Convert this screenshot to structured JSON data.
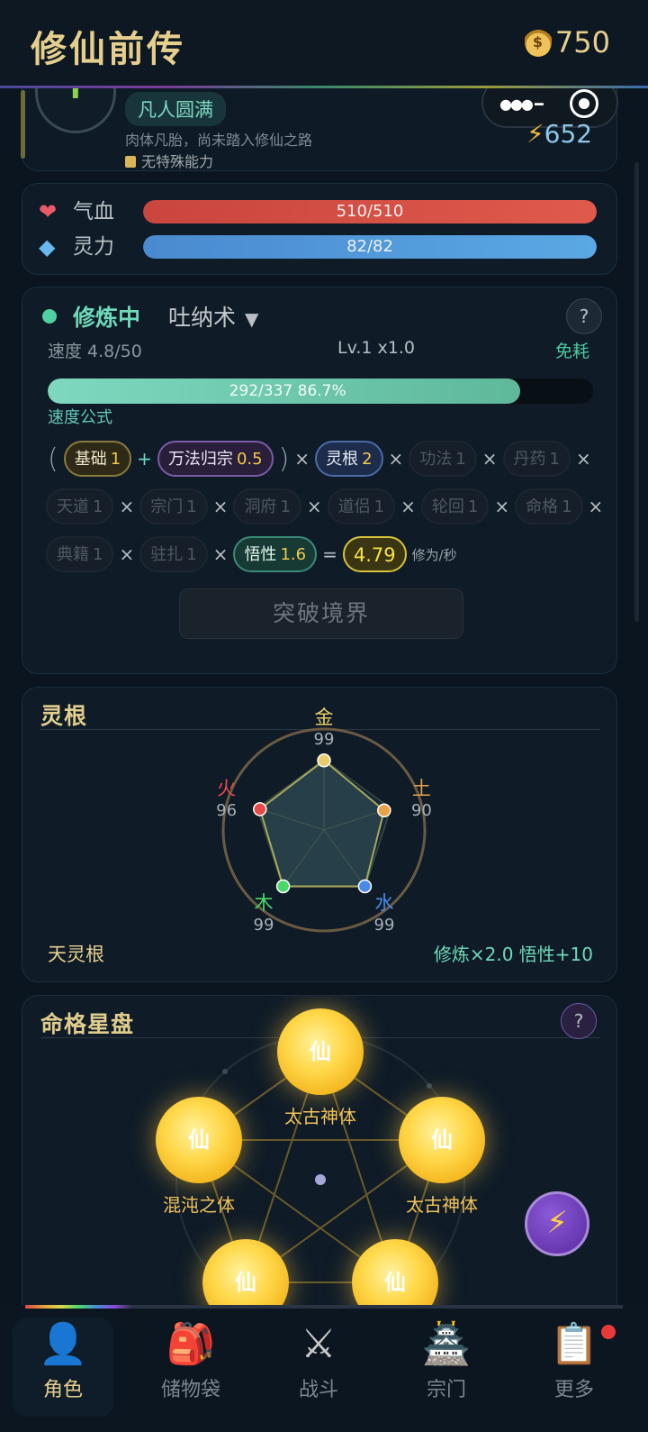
{
  "header": {
    "title": "修仙前传",
    "coins": "750",
    "coin_icon": "money-bag-icon"
  },
  "character": {
    "avatar_glyph": "r",
    "realm": "凡人圆满",
    "description": "肉体凡胎，尚未踏入修仙之路",
    "ability": "无特殊能力",
    "energy": "652",
    "energy_icon": "lightning-icon"
  },
  "stats": {
    "hp": {
      "label": "气血",
      "value": "510/510",
      "ratio": 1.0,
      "color": "#d9524a",
      "icon": "heart-icon"
    },
    "mp": {
      "label": "灵力",
      "value": "82/82",
      "ratio": 1.0,
      "color": "#4f9fdb",
      "icon": "diamond-icon"
    }
  },
  "cultivation": {
    "status": "修炼中",
    "method": "吐纳术",
    "speed": "速度 4.8/50",
    "level": "Lv.1 x1.0",
    "cost": "免耗",
    "progress_text": "292/337  86.7%",
    "progress_ratio": 0.867,
    "formula_title": "速度公式",
    "chips": {
      "base": {
        "label": "基础",
        "value": "1"
      },
      "wanfa": {
        "label": "万法归宗",
        "value": "0.5"
      },
      "linggen": {
        "label": "灵根",
        "value": "2"
      },
      "gongfa": {
        "label": "功法",
        "value": "1"
      },
      "danyao": {
        "label": "丹药",
        "value": "1"
      },
      "tiandao": {
        "label": "天道",
        "value": "1"
      },
      "zongmen": {
        "label": "宗门",
        "value": "1"
      },
      "dongfu": {
        "label": "洞府",
        "value": "1"
      },
      "daolv": {
        "label": "道侣",
        "value": "1"
      },
      "lunhui": {
        "label": "轮回",
        "value": "1"
      },
      "mingge": {
        "label": "命格",
        "value": "1"
      },
      "dianji": {
        "label": "典籍",
        "value": "1"
      },
      "zhuzha": {
        "label": "驻扎",
        "value": "1"
      },
      "wuxing": {
        "label": "悟性",
        "value": "1.6"
      }
    },
    "result": "4.79",
    "unit": "修为/秒",
    "breakthrough": "突破境界"
  },
  "spirit_root": {
    "title": "灵根",
    "elements": [
      {
        "name": "金",
        "value": "99",
        "color": "#e8cc6a"
      },
      {
        "name": "土",
        "value": "90",
        "color": "#e8a24a"
      },
      {
        "name": "水",
        "value": "99",
        "color": "#4a8ae8"
      },
      {
        "name": "木",
        "value": "99",
        "color": "#4ad86a"
      },
      {
        "name": "火",
        "value": "96",
        "color": "#e84a4a"
      }
    ],
    "root_name": "天灵根",
    "bonus": "修炼×2.0  悟性+10"
  },
  "star_chart": {
    "title": "命格星盘",
    "orbs": [
      {
        "glyph": "仙",
        "label": "太古神体"
      },
      {
        "glyph": "仙",
        "label": "太古神体"
      },
      {
        "glyph": "仙",
        "label": "混沌之体"
      },
      {
        "glyph": "仙",
        "label": ""
      },
      {
        "glyph": "仙",
        "label": ""
      }
    ]
  },
  "nav": [
    {
      "label": "角色",
      "icon": "person-icon"
    },
    {
      "label": "储物袋",
      "icon": "backpack-icon"
    },
    {
      "label": "战斗",
      "icon": "crossed-swords-icon"
    },
    {
      "label": "宗门",
      "icon": "pagoda-icon"
    },
    {
      "label": "更多",
      "icon": "clipboard-icon"
    }
  ]
}
